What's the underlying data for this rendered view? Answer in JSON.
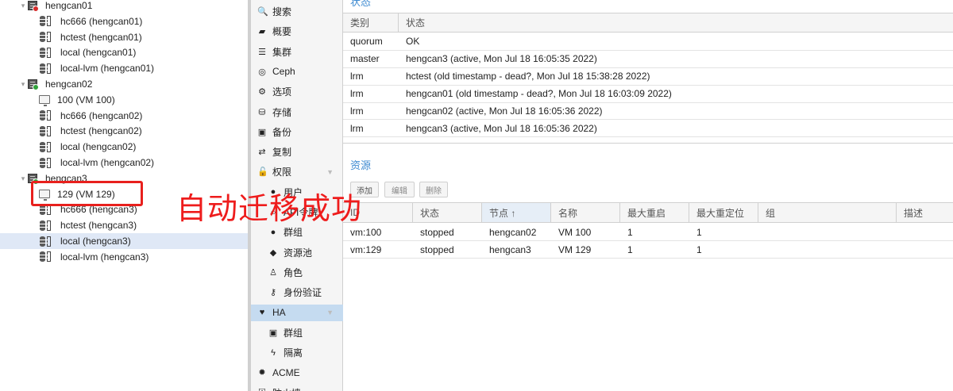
{
  "tree": {
    "nodes": [
      {
        "label": "hengcan01",
        "type": "node",
        "status": "error"
      },
      {
        "label": "hc666 (hengcan01)",
        "type": "storage"
      },
      {
        "label": "hctest (hengcan01)",
        "type": "storage"
      },
      {
        "label": "local (hengcan01)",
        "type": "storage"
      },
      {
        "label": "local-lvm (hengcan01)",
        "type": "storage"
      },
      {
        "label": "hengcan02",
        "type": "node",
        "status": "ok"
      },
      {
        "label": "100 (VM 100)",
        "type": "vm"
      },
      {
        "label": "hc666 (hengcan02)",
        "type": "storage"
      },
      {
        "label": "hctest (hengcan02)",
        "type": "storage"
      },
      {
        "label": "local (hengcan02)",
        "type": "storage"
      },
      {
        "label": "local-lvm (hengcan02)",
        "type": "storage"
      },
      {
        "label": "hengcan3",
        "type": "node",
        "status": "ok"
      },
      {
        "label": "129 (VM 129)",
        "type": "vm"
      },
      {
        "label": "hc666 (hengcan3)",
        "type": "storage"
      },
      {
        "label": "hctest (hengcan3)",
        "type": "storage"
      },
      {
        "label": "local (hengcan3)",
        "type": "storage",
        "selected": true
      },
      {
        "label": "local-lvm (hengcan3)",
        "type": "storage"
      }
    ]
  },
  "annotation": {
    "text": "自动迁移成功",
    "color": "#ee1c1c"
  },
  "menu": {
    "items": [
      {
        "label": "搜索",
        "icon": "search-icon",
        "glyph": "🔍"
      },
      {
        "label": "概要",
        "icon": "book-icon",
        "glyph": "▰"
      },
      {
        "label": "集群",
        "icon": "server-icon",
        "glyph": "☰"
      },
      {
        "label": "Ceph",
        "icon": "ceph-icon",
        "glyph": "◎"
      },
      {
        "label": "选项",
        "icon": "gear-icon",
        "glyph": "⚙"
      },
      {
        "label": "存储",
        "icon": "database-icon",
        "glyph": "⛁"
      },
      {
        "label": "备份",
        "icon": "floppy-icon",
        "glyph": "▣"
      },
      {
        "label": "复制",
        "icon": "retweet-icon",
        "glyph": "⇄"
      },
      {
        "label": "权限",
        "icon": "unlock-icon",
        "glyph": "🔓",
        "expandable": true
      },
      {
        "label": "用户",
        "icon": "user-icon",
        "glyph": "●",
        "sub": true
      },
      {
        "label": "API令牌",
        "icon": "user-outline-icon",
        "glyph": "○",
        "sub": true
      },
      {
        "label": "群组",
        "icon": "users-icon",
        "glyph": "●",
        "sub": true
      },
      {
        "label": "资源池",
        "icon": "tags-icon",
        "glyph": "◆",
        "sub": true
      },
      {
        "label": "角色",
        "icon": "male-icon",
        "glyph": "♙",
        "sub": true
      },
      {
        "label": "身份验证",
        "icon": "key-icon",
        "glyph": "⚷",
        "sub": true
      },
      {
        "label": "HA",
        "icon": "heartbeat-icon",
        "glyph": "♥",
        "expandable": true,
        "active": true
      },
      {
        "label": "群组",
        "icon": "object-group-icon",
        "glyph": "▣",
        "sub": true
      },
      {
        "label": "隔离",
        "icon": "bolt-icon",
        "glyph": "ϟ",
        "sub": true
      },
      {
        "label": "ACME",
        "icon": "certificate-icon",
        "glyph": "✹"
      },
      {
        "label": "防火墙",
        "icon": "shield-icon",
        "glyph": "⛨"
      }
    ]
  },
  "status_panel": {
    "title": "状态",
    "headers": [
      "类别",
      "状态"
    ],
    "rows": [
      [
        "quorum",
        "OK"
      ],
      [
        "master",
        "hengcan3 (active, Mon Jul 18 16:05:35 2022)"
      ],
      [
        "lrm",
        "hctest (old timestamp - dead?, Mon Jul 18 15:38:28 2022)"
      ],
      [
        "lrm",
        "hengcan01 (old timestamp - dead?, Mon Jul 18 16:03:09 2022)"
      ],
      [
        "lrm",
        "hengcan02 (active, Mon Jul 18 16:05:36 2022)"
      ],
      [
        "lrm",
        "hengcan3 (active, Mon Jul 18 16:05:36 2022)"
      ]
    ]
  },
  "resources_panel": {
    "title": "资源",
    "toolbar": {
      "add": "添加",
      "edit": "编辑",
      "remove": "删除"
    },
    "headers": [
      "ID",
      "状态",
      "节点 ↑",
      "名称",
      "最大重启",
      "最大重定位",
      "组",
      "描述"
    ],
    "rows": [
      [
        "vm:100",
        "stopped",
        "hengcan02",
        "VM 100",
        "1",
        "1",
        "",
        ""
      ],
      [
        "vm:129",
        "stopped",
        "hengcan3",
        "VM 129",
        "1",
        "1",
        "",
        ""
      ]
    ]
  },
  "colors": {
    "accent": "#3f8bd1",
    "active_menu": "#c5dbf0",
    "selected_row": "#dfe8f6",
    "error": "#d62b2b",
    "ok": "#30a13a"
  }
}
